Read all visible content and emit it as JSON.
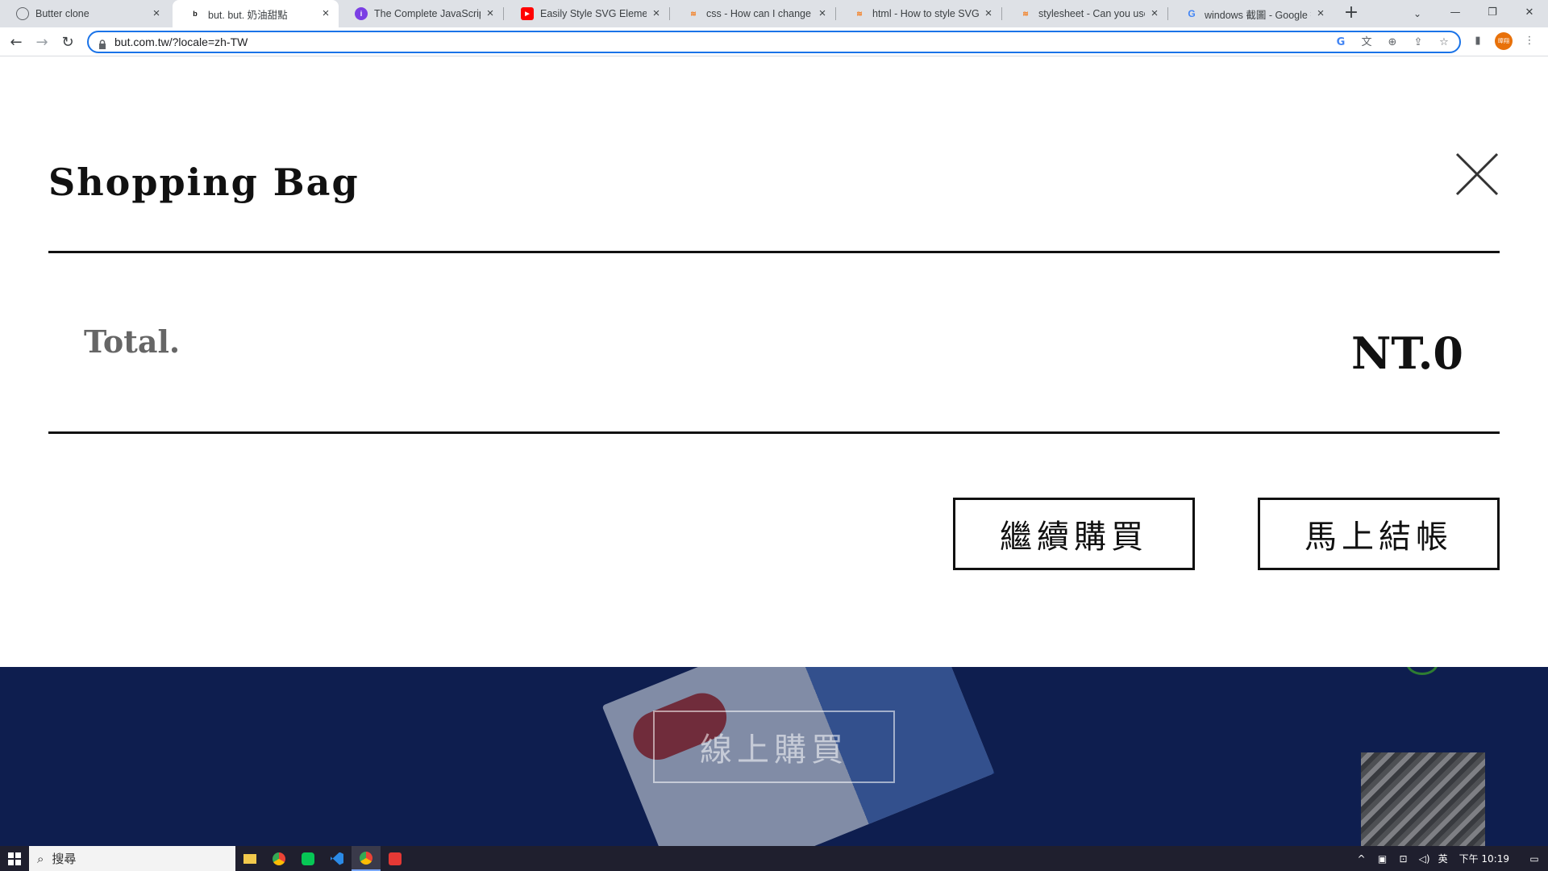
{
  "browser": {
    "tabs": [
      {
        "title": "Butter clone",
        "favicon": "globe-icon",
        "active": false
      },
      {
        "title": "but. but. 奶油甜點",
        "favicon": "but-logo-icon",
        "active": true
      },
      {
        "title": "The Complete JavaScript",
        "favicon": "course-icon",
        "active": false
      },
      {
        "title": "Easily Style SVG Elements",
        "favicon": "youtube-icon",
        "active": false
      },
      {
        "title": "css - How can I change th",
        "favicon": "stackoverflow-icon",
        "active": false
      },
      {
        "title": "html - How to style SVG",
        "favicon": "stackoverflow-icon",
        "active": false
      },
      {
        "title": "stylesheet - Can you use",
        "favicon": "stackoverflow-icon",
        "active": false
      },
      {
        "title": "windows 截圖 - Google 搜",
        "favicon": "google-icon",
        "active": false
      }
    ],
    "url": "but.com.tw/?locale=zh-TW",
    "profile_label": "暐翔"
  },
  "cart": {
    "title": "Shopping Bag",
    "total_label": "Total.",
    "total_value": "NT.0",
    "continue_label": "繼續購買",
    "checkout_label": "馬上結帳"
  },
  "background": {
    "buy_online_label": "線上購買"
  },
  "taskbar": {
    "search_placeholder": "搜尋",
    "ime": "英",
    "time": "下午 10:19"
  },
  "colors": {
    "accent": "#1a73e8",
    "text": "#111111",
    "muted": "#666666",
    "page_bg": "#0e1e4f"
  }
}
